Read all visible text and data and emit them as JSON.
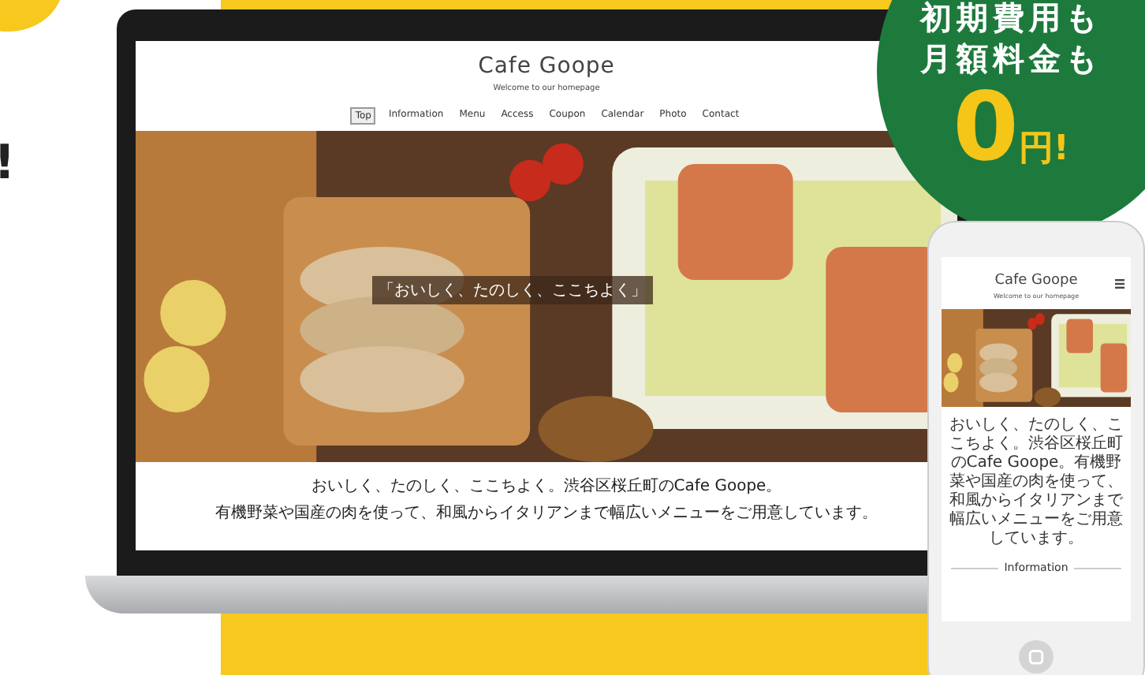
{
  "side_text": "!",
  "laptop_site": {
    "title": "Cafe Goope",
    "tagline": "Welcome to our homepage",
    "nav": [
      {
        "label": "Top",
        "selected": true
      },
      {
        "label": "Information",
        "selected": false
      },
      {
        "label": "Menu",
        "selected": false
      },
      {
        "label": "Access",
        "selected": false
      },
      {
        "label": "Coupon",
        "selected": false
      },
      {
        "label": "Calendar",
        "selected": false
      },
      {
        "label": "Photo",
        "selected": false
      },
      {
        "label": "Contact",
        "selected": false
      }
    ],
    "hero_text": "「おいしく、たのしく、ここちよく」",
    "intro": [
      "おいしく、たのしく、ここちよく。渋谷区桜丘町のCafe Goope。",
      "有機野菜や国産の肉を使って、和風からイタリアンまで幅広いメニューをご用意しています。"
    ]
  },
  "phone_site": {
    "title": "Cafe Goope",
    "tagline": "Welcome to our homepage",
    "intro": "おいしく、たのしく、ここちよく。渋谷区桜丘町のCafe Goope。有機野菜や国産の肉を使って、和風からイタリアンまで幅広いメニューをご用意しています。",
    "section": "Information"
  },
  "badge": {
    "lines": [
      "初期費用も",
      "月額料金も"
    ],
    "price": "0",
    "unit": "円!"
  }
}
